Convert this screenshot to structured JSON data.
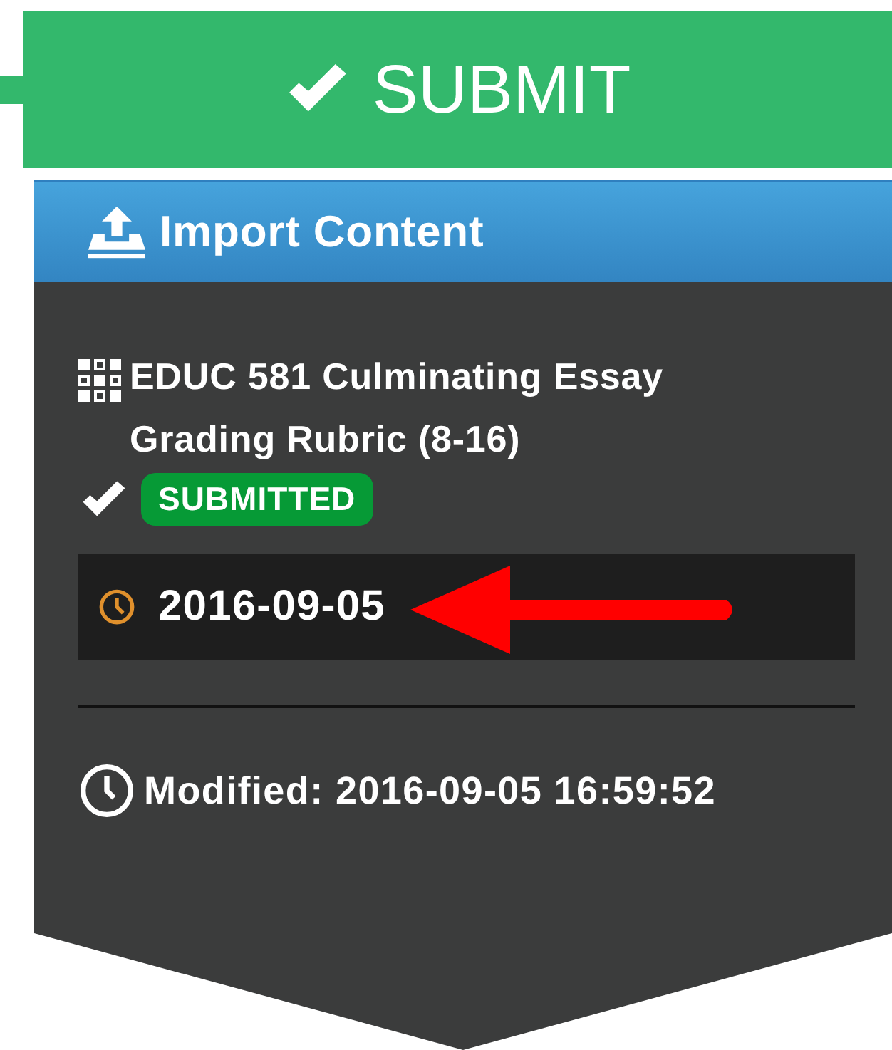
{
  "submit_button": {
    "label": "SUBMIT"
  },
  "import_button": {
    "label": "Import Content"
  },
  "item": {
    "title": "EDUC 581 Culminating Essay Grading Rubric (8-16)",
    "submitted": true,
    "status": "SUBMITTED",
    "due_date": "2016-09-05",
    "modified": "Modified: 2016-09-05 16:59:52"
  }
}
